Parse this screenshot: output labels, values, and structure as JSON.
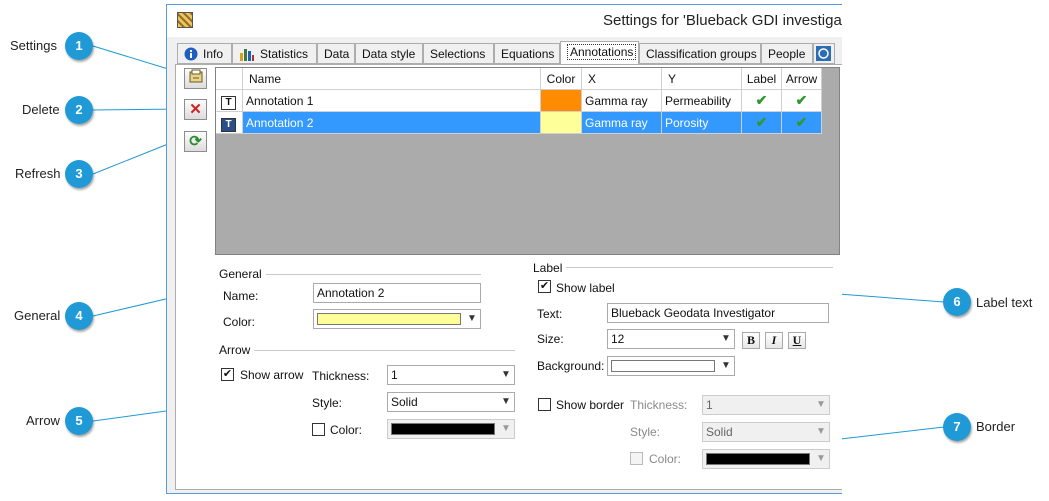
{
  "window": {
    "title": "Settings for 'Blueback GDI investigat"
  },
  "tabs": [
    {
      "label": "Info",
      "icon": "info-icon"
    },
    {
      "label": "Statistics",
      "icon": "bar-chart-icon"
    },
    {
      "label": "Data"
    },
    {
      "label": "Data style"
    },
    {
      "label": "Selections"
    },
    {
      "label": "Equations"
    },
    {
      "label": "Annotations",
      "active": true
    },
    {
      "label": "Classification groups"
    },
    {
      "label": "People"
    }
  ],
  "grid": {
    "headers": {
      "name": "Name",
      "color": "Color",
      "x": "X",
      "y": "Y",
      "label": "Label",
      "arrow": "Arrow"
    },
    "rows": [
      {
        "icon": "T",
        "name": "Annotation 1",
        "color": "#ff8c00",
        "x": "Gamma ray",
        "y": "Permeability",
        "label": "✔",
        "arrow": "✔",
        "selected": false
      },
      {
        "icon": "T",
        "name": "Annotation 2",
        "color": "#ffff99",
        "x": "Gamma ray",
        "y": "Porosity",
        "label": "✔",
        "arrow": "✔",
        "selected": true
      }
    ]
  },
  "general": {
    "title": "General",
    "name_label": "Name:",
    "name_value": "Annotation 2",
    "color_label": "Color:",
    "color_value": "#ffff99"
  },
  "arrow": {
    "title": "Arrow",
    "show_label": "Show arrow",
    "thickness_label": "Thickness:",
    "thickness_value": "1",
    "style_label": "Style:",
    "style_value": "Solid",
    "color_label": "Color:",
    "color_value": "#000000"
  },
  "label": {
    "title": "Label",
    "show_label": "Show label",
    "text_label": "Text:",
    "text_value": "Blueback Geodata Investigator",
    "size_label": "Size:",
    "size_value": "12",
    "bold": "B",
    "italic": "I",
    "underline": "U",
    "background_label": "Background:",
    "show_border_label": "Show border",
    "thickness_label": "Thickness:",
    "thickness_value": "1",
    "style_label": "Style:",
    "style_value": "Solid",
    "color_label": "Color:",
    "color_value": "#000000"
  },
  "callouts": [
    {
      "num": "1",
      "label": "Settings"
    },
    {
      "num": "2",
      "label": "Delete"
    },
    {
      "num": "3",
      "label": "Refresh"
    },
    {
      "num": "4",
      "label": "General"
    },
    {
      "num": "5",
      "label": "Arrow"
    },
    {
      "num": "6",
      "label": "Label text"
    },
    {
      "num": "7",
      "label": "Border"
    }
  ],
  "colors": {
    "accent": "#1f9ad6",
    "selection": "#3399ff",
    "window_border": "#5b9bd5"
  }
}
